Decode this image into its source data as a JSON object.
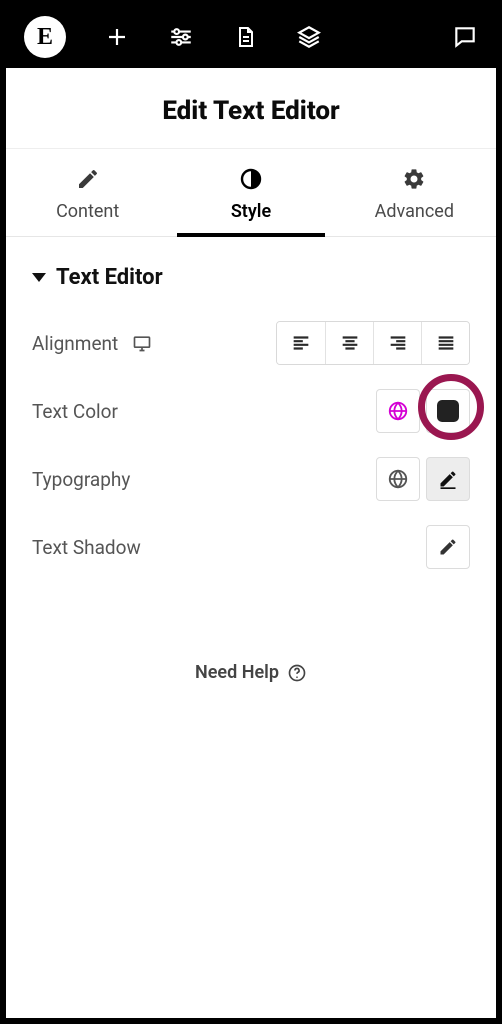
{
  "title": "Edit Text Editor",
  "tabs": {
    "content": "Content",
    "style": "Style",
    "advanced": "Advanced"
  },
  "section": {
    "title": "Text Editor"
  },
  "controls": {
    "alignment": "Alignment",
    "text_color": "Text Color",
    "typography": "Typography",
    "text_shadow": "Text Shadow"
  },
  "help": "Need Help",
  "colors": {
    "swatch": "#222222",
    "highlight_ring": "#9a1750"
  }
}
